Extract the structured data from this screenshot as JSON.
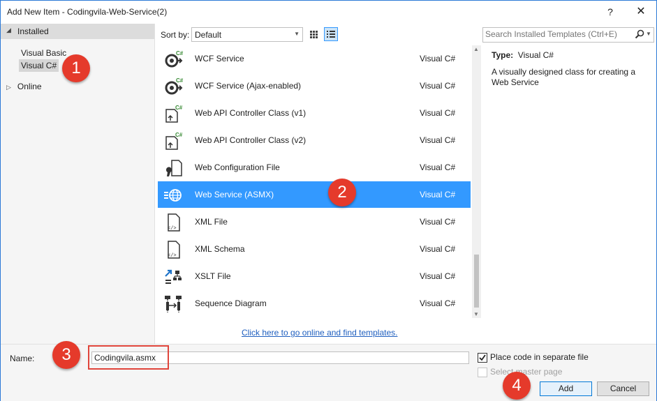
{
  "window": {
    "title": "Add New Item - Codingvila-Web-Service(2)",
    "help_label": "?",
    "close_label": "✕"
  },
  "left": {
    "installed_label": "Installed",
    "languages": [
      "Visual Basic",
      "Visual C#"
    ],
    "selected_language": "Visual C#",
    "online_label": "Online"
  },
  "toolbar": {
    "sort_label": "Sort by:",
    "sort_value": "Default"
  },
  "templates": [
    {
      "name": "WCF Service",
      "lang": "Visual C#",
      "icon": "wcf-service-icon"
    },
    {
      "name": "WCF Service (Ajax-enabled)",
      "lang": "Visual C#",
      "icon": "wcf-ajax-service-icon"
    },
    {
      "name": "Web API Controller Class (v1)",
      "lang": "Visual C#",
      "icon": "web-api-controller-icon"
    },
    {
      "name": "Web API Controller Class (v2)",
      "lang": "Visual C#",
      "icon": "web-api-controller-icon"
    },
    {
      "name": "Web Configuration File",
      "lang": "Visual C#",
      "icon": "config-file-icon"
    },
    {
      "name": "Web Service (ASMX)",
      "lang": "Visual C#",
      "icon": "web-service-globe-icon",
      "selected": true
    },
    {
      "name": "XML File",
      "lang": "Visual C#",
      "icon": "xml-file-icon"
    },
    {
      "name": "XML Schema",
      "lang": "Visual C#",
      "icon": "xml-schema-icon"
    },
    {
      "name": "XSLT File",
      "lang": "Visual C#",
      "icon": "xslt-file-icon"
    },
    {
      "name": "Sequence Diagram",
      "lang": "Visual C#",
      "icon": "sequence-diagram-icon"
    }
  ],
  "online_link": "Click here to go online and find templates.",
  "search": {
    "placeholder": "Search Installed Templates (Ctrl+E)"
  },
  "details": {
    "type_label": "Type:",
    "type_value": "Visual C#",
    "description": "A visually designed class for creating a Web Service"
  },
  "bottom": {
    "name_label": "Name:",
    "name_value": "Codingvila.asmx",
    "place_code_label": "Place code in separate file",
    "place_code_checked": true,
    "master_page_label": "Select master page",
    "master_page_enabled": false,
    "add_label": "Add",
    "cancel_label": "Cancel"
  },
  "annotations": [
    "1",
    "2",
    "3",
    "4"
  ],
  "colors": {
    "accent": "#3399ff",
    "callout": "#e53a2b",
    "link": "#1f5fbf"
  }
}
